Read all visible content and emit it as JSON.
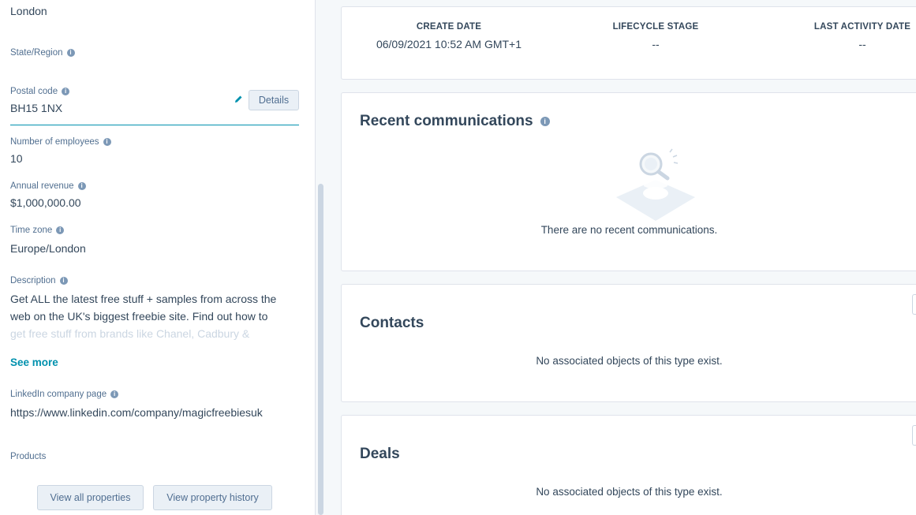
{
  "left_panel": {
    "city_value": "London",
    "state": {
      "label": "State/Region"
    },
    "postal": {
      "label": "Postal code",
      "value": "BH15 1NX",
      "details_label": "Details"
    },
    "employees": {
      "label": "Number of employees",
      "value": "10"
    },
    "revenue": {
      "label": "Annual revenue",
      "value": "$1,000,000.00"
    },
    "timezone": {
      "label": "Time zone",
      "value": "Europe/London"
    },
    "description": {
      "label": "Description",
      "line1": "Get ALL the latest free stuff + samples from across the",
      "line2": "web on the UK's biggest freebie site. Find out how to",
      "line3": "get free stuff from brands like Chanel, Cadbury &",
      "see_more": "See more"
    },
    "linkedin": {
      "label": "LinkedIn company page",
      "value": "https://www.linkedin.com/company/magicfreebiesuk"
    },
    "products": {
      "label": "Products"
    },
    "view_all_label": "View all properties",
    "view_history_label": "View property history"
  },
  "summary": {
    "create_date": {
      "label": "CREATE DATE",
      "value": "06/09/2021 10:52 AM GMT+1"
    },
    "lifecycle": {
      "label": "LIFECYCLE STAGE",
      "value": "--"
    },
    "last_activity": {
      "label": "LAST ACTIVITY DATE",
      "value": "--"
    }
  },
  "communications": {
    "title": "Recent communications",
    "empty_text": "There are no recent communications."
  },
  "contacts": {
    "title": "Contacts",
    "empty_text": "No associated objects of this type exist."
  },
  "deals": {
    "title": "Deals",
    "empty_text": "No associated objects of this type exist."
  },
  "colors": {
    "accent": "#0091ae",
    "text": "#33475b",
    "label": "#516f90",
    "button_bg": "#eaf0f6",
    "border": "#cbd6e2"
  },
  "icons": [
    "info-icon",
    "pencil-icon",
    "search-illustration-icon"
  ]
}
